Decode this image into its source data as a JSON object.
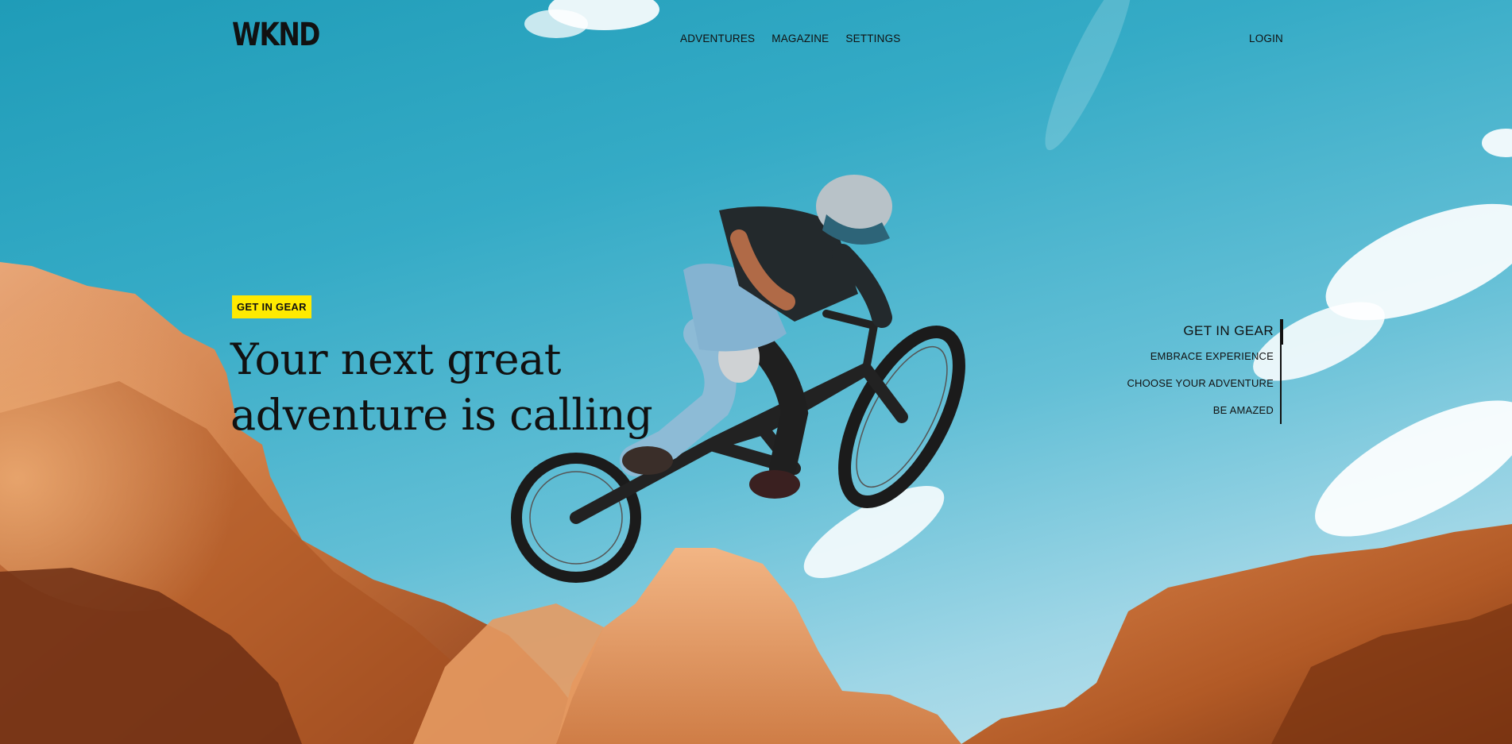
{
  "header": {
    "logo": "WKND",
    "nav": [
      {
        "label": "ADVENTURES"
      },
      {
        "label": "MAGAZINE"
      },
      {
        "label": "SETTINGS"
      }
    ],
    "login_label": "LOGIN"
  },
  "hero": {
    "tag": "GET IN GEAR",
    "headline": "Your next great adventure is calling",
    "background_image": "mountain-biker-jumping-over-red-rocks"
  },
  "carousel": {
    "items": [
      {
        "label": "GET IN GEAR",
        "active": true
      },
      {
        "label": "EMBRACE EXPERIENCE",
        "active": false
      },
      {
        "label": "CHOOSE YOUR ADVENTURE",
        "active": false
      },
      {
        "label": "BE AMAZED",
        "active": false
      }
    ]
  },
  "colors": {
    "accent_yellow": "#ffea00",
    "text": "#111111",
    "sky": "#35abc6",
    "rock": "#c96a2d"
  }
}
